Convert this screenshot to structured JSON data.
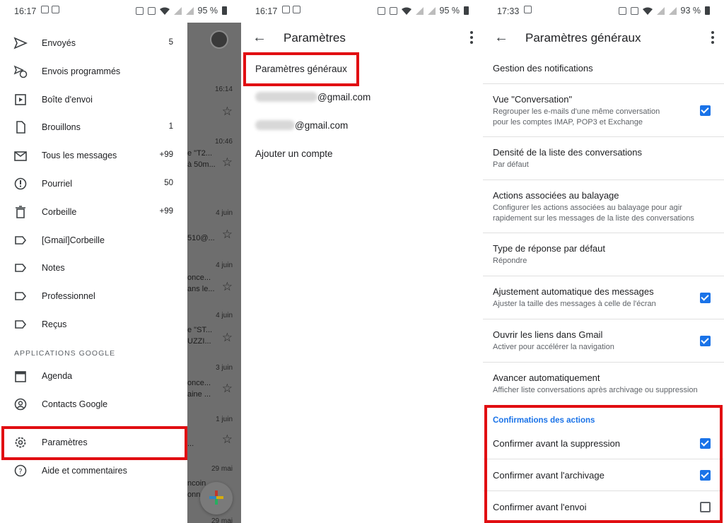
{
  "colors": {
    "accent": "#1a73e8",
    "highlight": "#e10e12",
    "scrim": "#6e6e6e"
  },
  "panel1": {
    "status": {
      "time": "16:17",
      "battery": "95 %"
    },
    "drawer": {
      "items": [
        {
          "label": "Envoyés",
          "count": "5",
          "icon": "send-icon"
        },
        {
          "label": "Envois programmés",
          "count": "",
          "icon": "scheduled-send-icon"
        },
        {
          "label": "Boîte d'envoi",
          "count": "",
          "icon": "outbox-icon"
        },
        {
          "label": "Brouillons",
          "count": "1",
          "icon": "draft-icon"
        },
        {
          "label": "Tous les messages",
          "count": "+99",
          "icon": "all-mail-icon"
        },
        {
          "label": "Pourriel",
          "count": "50",
          "icon": "spam-icon"
        },
        {
          "label": "Corbeille",
          "count": "+99",
          "icon": "trash-icon"
        },
        {
          "label": "[Gmail]Corbeille",
          "count": "",
          "icon": "label-icon"
        },
        {
          "label": "Notes",
          "count": "",
          "icon": "label-icon"
        },
        {
          "label": "Professionnel",
          "count": "",
          "icon": "label-icon"
        },
        {
          "label": "Reçus",
          "count": "",
          "icon": "label-icon"
        }
      ],
      "section_title": "APPLICATIONS GOOGLE",
      "apps": [
        {
          "label": "Agenda",
          "icon": "calendar-icon"
        },
        {
          "label": "Contacts Google",
          "icon": "contacts-icon"
        }
      ],
      "settings": {
        "label": "Paramètres",
        "icon": "gear-icon"
      },
      "help": {
        "label": "Aide et commentaires",
        "icon": "help-icon"
      }
    },
    "inbox_behind": {
      "times": [
        "16:14",
        "10:46",
        "4 juin",
        "4 juin",
        "4 juin",
        "3 juin",
        "1 juin",
        "29 mai",
        "29 mai"
      ],
      "snippets": [
        "e \"T2...",
        "à 50m...",
        "510@...",
        "once...",
        "ans le...",
        "e \"ST...",
        "UZZI...",
        "once...",
        "aine ...",
        "...",
        "ncoin",
        "onn"
      ]
    }
  },
  "panel2": {
    "status": {
      "time": "16:17",
      "battery": "95 %"
    },
    "title": "Paramètres",
    "items": [
      {
        "label": "Paramètres généraux"
      },
      {
        "label": "@gmail.com"
      },
      {
        "label": "@gmail.com"
      },
      {
        "label": "Ajouter un compte"
      }
    ]
  },
  "panel3": {
    "status": {
      "time": "17:33",
      "battery": "93 %"
    },
    "title": "Paramètres généraux",
    "rows": [
      {
        "title": "Gestion des notifications",
        "sub": [],
        "checkbox": null
      },
      {
        "title": "Vue \"Conversation\"",
        "sub": [
          "Regrouper les e-mails d'une même conversation",
          "pour les comptes IMAP, POP3 et Exchange"
        ],
        "checkbox": true
      },
      {
        "title": "Densité de la liste des conversations",
        "sub": [
          "Par défaut"
        ],
        "checkbox": null
      },
      {
        "title": "Actions associées au balayage",
        "sub": [
          "Configurer les actions associées au balayage pour agir",
          "rapidement sur les messages de la liste des conversations"
        ],
        "checkbox": null
      },
      {
        "title": "Type de réponse par défaut",
        "sub": [
          "Répondre"
        ],
        "checkbox": null
      },
      {
        "title": "Ajustement automatique des messages",
        "sub": [
          "Ajuster la taille des messages à celle de l'écran"
        ],
        "checkbox": true
      },
      {
        "title": "Ouvrir les liens dans Gmail",
        "sub": [
          "Activer pour accélérer la navigation"
        ],
        "checkbox": true
      },
      {
        "title": "Avancer automatiquement",
        "sub": [
          "Afficher liste conversations après archivage ou suppression"
        ],
        "checkbox": null
      }
    ],
    "confirm_section": "Confirmations des actions",
    "confirm_rows": [
      {
        "title": "Confirmer avant la suppression",
        "checkbox": true
      },
      {
        "title": "Confirmer avant l'archivage",
        "checkbox": true
      },
      {
        "title": "Confirmer avant l'envoi",
        "checkbox": false
      }
    ]
  }
}
